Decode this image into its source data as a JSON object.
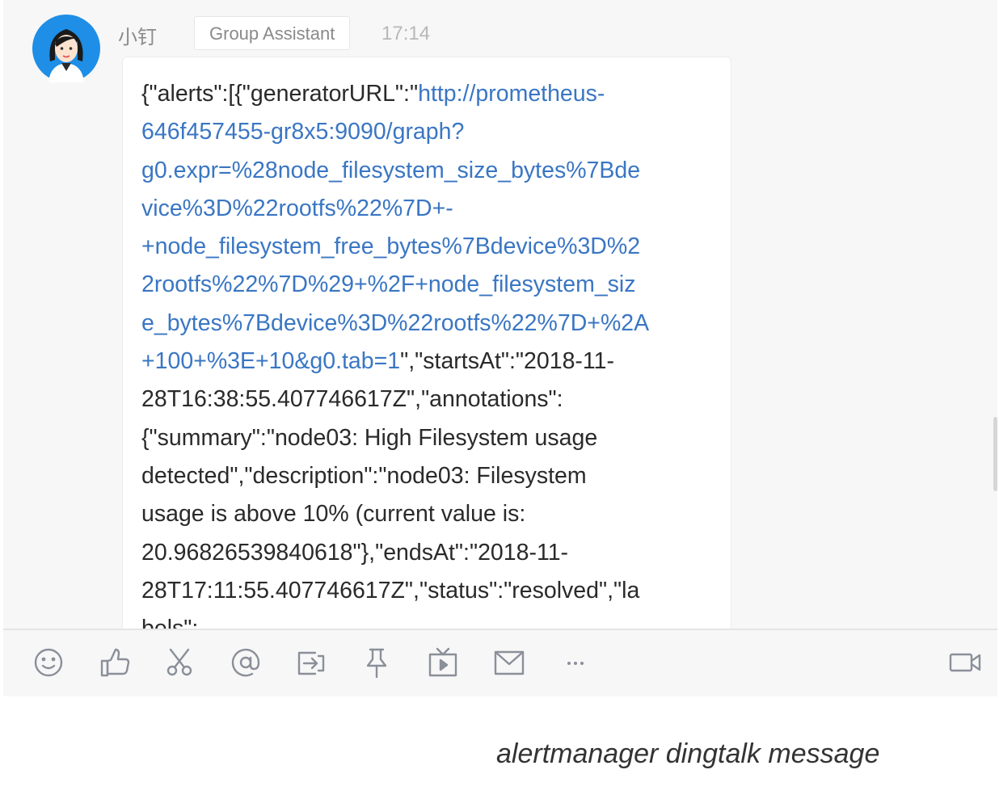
{
  "message": {
    "sender": "小钉",
    "role_badge": "Group Assistant",
    "time": "17:14",
    "lines": [
      [
        {
          "t": "{\"alerts\":[{\"generatorURL\":\"",
          "link": false
        },
        {
          "t": "http://prometheus-",
          "link": true
        }
      ],
      [
        {
          "t": "646f457455-gr8x5:9090/graph?",
          "link": true
        }
      ],
      [
        {
          "t": "g0.expr=%28node_filesystem_size_bytes%7Bde",
          "link": true
        }
      ],
      [
        {
          "t": "vice%3D%22rootfs%22%7D+-",
          "link": true
        }
      ],
      [
        {
          "t": "+node_filesystem_free_bytes%7Bdevice%3D%2",
          "link": true
        }
      ],
      [
        {
          "t": "2rootfs%22%7D%29+%2F+node_filesystem_siz",
          "link": true
        }
      ],
      [
        {
          "t": "e_bytes%7Bdevice%3D%22rootfs%22%7D+%2A",
          "link": true
        }
      ],
      [
        {
          "t": "+100+%3E+10&g0.tab=1",
          "link": true
        },
        {
          "t": "\",\"startsAt\":\"2018-11-",
          "link": false
        }
      ],
      [
        {
          "t": "28T16:38:55.407746617Z\",\"annotations\":",
          "link": false
        }
      ],
      [
        {
          "t": "{\"summary\":\"node03: High Filesystem usage",
          "link": false
        }
      ],
      [
        {
          "t": "detected\",\"description\":\"node03: Filesystem",
          "link": false
        }
      ],
      [
        {
          "t": "usage is above 10% (current value is:",
          "link": false
        }
      ],
      [
        {
          "t": "20.96826539840618\"},\"endsAt\":\"2018-11-",
          "link": false
        }
      ],
      [
        {
          "t": "28T17:11:55.407746617Z\",\"status\":\"resolved\",\"la",
          "link": false
        }
      ],
      [
        {
          "t": "bels\":",
          "link": false
        }
      ]
    ]
  },
  "toolbar": {
    "left_icons": [
      "smile-icon",
      "thumbs-up-icon",
      "scissors-icon",
      "at-icon",
      "forward-icon",
      "pin-icon",
      "live-icon",
      "mail-icon",
      "more-icon"
    ],
    "right_icons": [
      "video-call-icon"
    ]
  },
  "caption": "alertmanager dingtalk message",
  "colors": {
    "link": "#3a76c3",
    "text": "#2a2a2a",
    "panel_bg": "#f7f7f7",
    "icon": "#8a8f99"
  }
}
